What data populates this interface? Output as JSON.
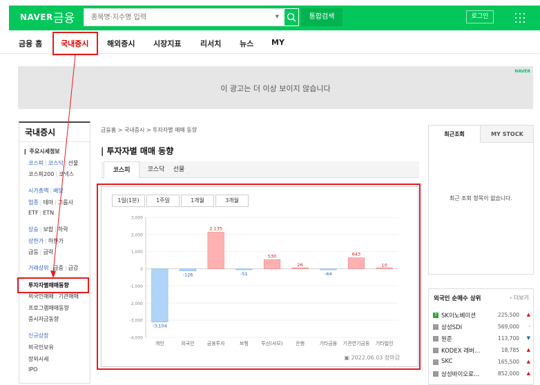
{
  "header": {
    "logo_naver": "NAVER",
    "logo_finance": "금융",
    "search_placeholder": "종목명·지수명 입력",
    "unified_search": "통합검색",
    "login": "로그인"
  },
  "nav": {
    "items": [
      "금융 홈",
      "국내증시",
      "해외증시",
      "시장지표",
      "리서치",
      "뉴스",
      "MY"
    ]
  },
  "ad": {
    "text": "이 광고는 더 이상 보이지 않습니다",
    "logo": "NAVER"
  },
  "sidebar": {
    "title": "국내증시",
    "section_main": "주요시세정보",
    "row1": [
      "코스피",
      "코스닥",
      "선물"
    ],
    "row2": [
      "코스피200",
      "코넥스"
    ],
    "row3": [
      "시가총액",
      "배당"
    ],
    "row4": [
      "업종",
      "테마",
      "그룹사"
    ],
    "row5": [
      "ETF",
      "ETN"
    ],
    "row6": [
      "상승",
      "보합",
      "하락"
    ],
    "row7": [
      "상한가",
      "하한가"
    ],
    "row8": [
      "급등",
      "급락"
    ],
    "row9": [
      "거래상위",
      "급증",
      "급감"
    ],
    "investor": "투자자별매매동향",
    "foreign_trade": "외국인매매",
    "inst_trade": "기관매매",
    "program": "프로그램매매동향",
    "margin": "증시자금동향",
    "newlist": "신규상장",
    "foreign_hold": "외국인보유",
    "offhours": "장외시세",
    "ipo": "IPO"
  },
  "main": {
    "breadcrumb": "금융홈 > 국내증시 > 투자자별 매매 동향",
    "title": "투자자별 매매 동향",
    "tabs": [
      "코스피",
      "코스닥",
      "선물"
    ],
    "period_tabs": [
      "1일(1분)",
      "1주일",
      "1개월",
      "3개월"
    ],
    "footer": "2022.06.03 장마감"
  },
  "chart_data": {
    "type": "bar",
    "categories": [
      "개인",
      "외국인",
      "금융투자",
      "보험",
      "투신(사모)",
      "은행",
      "기타금융",
      "기관연기금등",
      "기타법인"
    ],
    "values": [
      -3104,
      -126,
      2135,
      -51,
      530,
      26,
      -64,
      643,
      10
    ],
    "value_labels": [
      "-3,104",
      "-126",
      "2,135",
      "-51",
      "530",
      "26",
      "-64",
      "643",
      "10"
    ],
    "ylim": [
      -4000,
      3000
    ],
    "yticks": [
      3000,
      2000,
      1000,
      0,
      -1000,
      -2000,
      -3000,
      -4000
    ],
    "ytick_labels": [
      "3,000",
      "2,000",
      "1,000",
      "0",
      "-1,000",
      "-2,000",
      "-3,000",
      "-4,000"
    ],
    "colors": {
      "positive": "#ffb1b1",
      "negative": "#b0d4f8",
      "pos_label": "#d41a1a",
      "neg_label": "#1f5fbf"
    }
  },
  "right": {
    "tab_recent": "최근조회",
    "tab_mystock": "MY STOCK",
    "empty": "최근 조회 항목이 없습니다."
  },
  "foreign_top": {
    "title": "외국인 순매수 상위",
    "more": "› 더보기",
    "rows": [
      {
        "name": "SK이노베이션",
        "price": "225,500",
        "dir": "▲",
        "color": "#d41a1a",
        "badge": "up"
      },
      {
        "name": "삼성SDI",
        "price": "569,000",
        "dir": "-",
        "color": "#555555",
        "badge": ""
      },
      {
        "name": "원준",
        "price": "113,700",
        "dir": "▼",
        "color": "#1f5fbf",
        "badge": ""
      },
      {
        "name": "KODEX 레버…",
        "price": "18,785",
        "dir": "▲",
        "color": "#d41a1a",
        "badge": ""
      },
      {
        "name": "SKC",
        "price": "165,500",
        "dir": "▲",
        "color": "#d41a1a",
        "badge": ""
      },
      {
        "name": "삼성바이오로…",
        "price": "852,000",
        "dir": "▲",
        "color": "#d41a1a",
        "badge": ""
      }
    ]
  }
}
